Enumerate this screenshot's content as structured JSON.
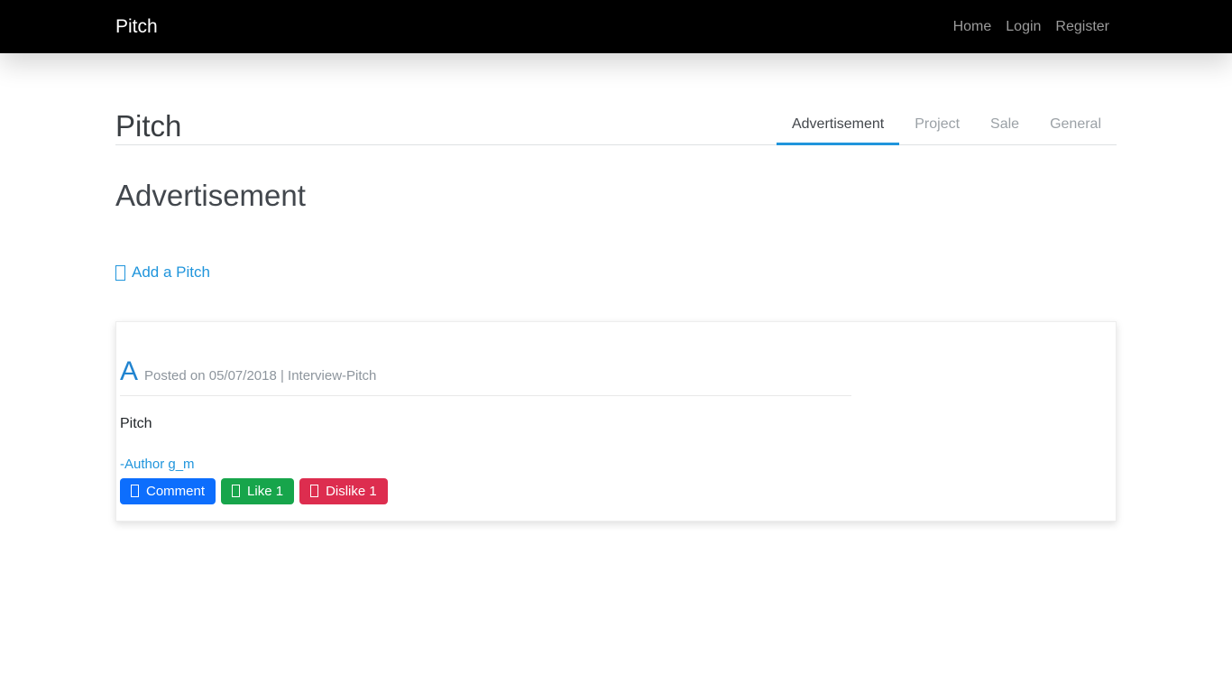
{
  "navbar": {
    "brand": "Pitch",
    "links": [
      {
        "label": "Home"
      },
      {
        "label": "Login"
      },
      {
        "label": "Register"
      }
    ]
  },
  "header": {
    "title": "Pitch",
    "tabs": [
      {
        "label": "Advertisement",
        "active": true
      },
      {
        "label": "Project",
        "active": false
      },
      {
        "label": "Sale",
        "active": false
      },
      {
        "label": "General",
        "active": false
      }
    ]
  },
  "main": {
    "section_title": "Advertisement",
    "add_link_label": "Add a Pitch",
    "card": {
      "author_initial": "A",
      "meta": "Posted on 05/07/2018 | Interview-Pitch",
      "body_text": "Pitch",
      "author_link": "-Author g_m",
      "buttons": [
        {
          "label": "Comment",
          "color": "#0d6efd"
        },
        {
          "label": "Like 1",
          "color": "#17a54b"
        },
        {
          "label": "Dislike 1",
          "color": "#dd2d4f"
        }
      ]
    }
  },
  "icons": {
    "add": "missing-glyph-box",
    "comment": "missing-glyph-box",
    "like": "missing-glyph-box",
    "dislike": "missing-glyph-box"
  },
  "colors": {
    "navbar_bg": "#000000",
    "navbar_link": "#9b9b9b",
    "accent_blue": "#2095dc",
    "muted_text": "#8d959d",
    "comment_blue": "#0d6efd",
    "like_green": "#17a54b",
    "dislike_red": "#dd2d4f"
  }
}
